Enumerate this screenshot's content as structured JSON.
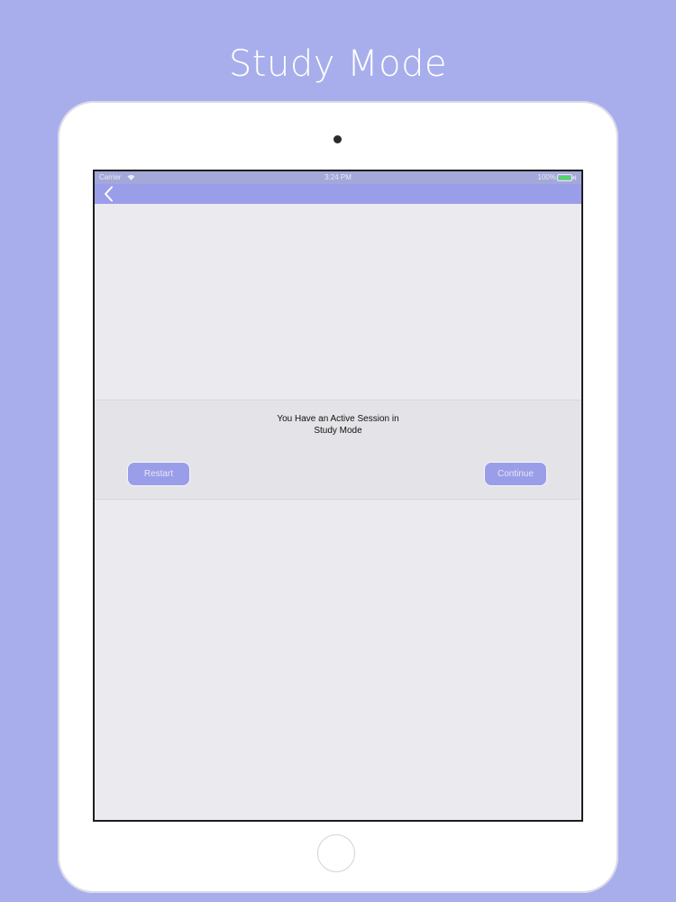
{
  "promo": {
    "title": "Study Mode"
  },
  "status_bar": {
    "carrier": "Carrier",
    "time": "3:24 PM",
    "battery": "100%"
  },
  "nav_bar": {
    "back_icon": "chevron-left-icon"
  },
  "session_panel": {
    "message_line1": "You Have an Active Session in",
    "message_line2": "Study Mode",
    "restart_label": "Restart",
    "continue_label": "Continue"
  },
  "colors": {
    "background": "#a8aeec",
    "accent": "#9a9de8",
    "screen_background": "#ebeaee",
    "battery_green": "#4cd964"
  }
}
